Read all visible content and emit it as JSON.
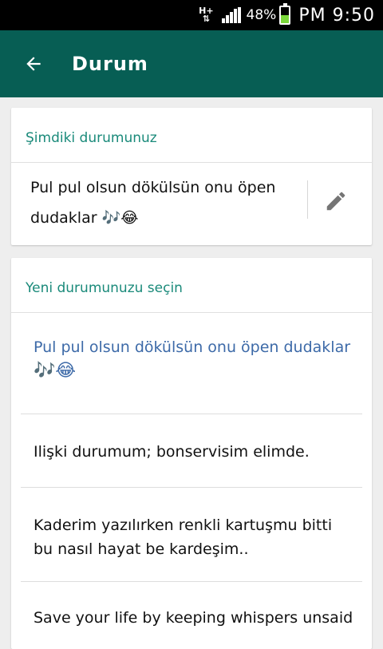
{
  "status_bar": {
    "network": "H+",
    "battery_percent": "48%",
    "battery_level": 0.48,
    "time": "PM 9:50"
  },
  "app_bar": {
    "title": "Durum",
    "back_icon": "arrow-back-icon"
  },
  "current_status": {
    "header": "Şimdiki durumunuz",
    "text_line1": "Pul pul olsun dökülsün onu öpen",
    "text_line2": "dudaklar 🎶😂",
    "edit_icon": "pencil-icon"
  },
  "choose_status": {
    "header": "Yeni durumunuzu seçin",
    "items": [
      {
        "line1": "Pul pul olsun dökülsün onu öpen dudaklar",
        "line2": "🎶😂"
      },
      {
        "line1": "Ilişki durumum; bonservisim elimde.",
        "line2": ""
      },
      {
        "line1": "Kaderim yazılırken renkli kartuşmu bitti",
        "line2": "bu nasıl hayat be kardeşim.."
      },
      {
        "line1": "Save your life by keeping whispers unsaid",
        "line2": ""
      }
    ]
  },
  "colors": {
    "app_bar": "#075e54",
    "accent": "#1a8a7a",
    "selected_text": "#3d6aa8"
  }
}
